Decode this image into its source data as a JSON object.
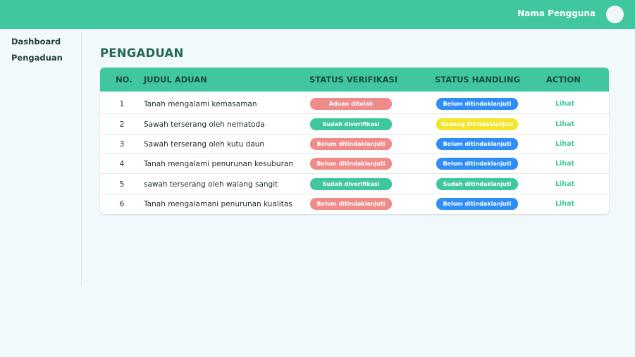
{
  "header": {
    "username": "Nama Pengguna"
  },
  "sidebar": {
    "items": [
      {
        "label": "Dashboard"
      },
      {
        "label": "Pengaduan"
      }
    ]
  },
  "page": {
    "title": "PENGADUAN"
  },
  "colors": {
    "accent": "#40c79f",
    "red": "#ef8b8b",
    "blue": "#2f8ef5",
    "yellow": "#f3e52b"
  },
  "table": {
    "columns": [
      "NO.",
      "JUDUL ADUAN",
      "STATUS VERIFIKASI",
      "STATUS HANDLING",
      "ACTION"
    ],
    "rows": [
      {
        "no": "1",
        "title": "Tanah mengalami kemasaman",
        "verif": "Aduan ditolak",
        "verif_color": "red",
        "handling": "Belum ditindaklanjuti",
        "handling_color": "blue",
        "action": "Lihat"
      },
      {
        "no": "2",
        "title": "Sawah terserang oleh nematoda",
        "verif": "Sudah diverifikasi",
        "verif_color": "green",
        "handling": "Sedang ditindaklanjuti",
        "handling_color": "yellow",
        "action": "Lihat"
      },
      {
        "no": "3",
        "title": "Sawah terserang oleh kutu daun",
        "verif": "Belum ditindaklanjuti",
        "verif_color": "red",
        "handling": "Belum ditindaklanjuti",
        "handling_color": "blue",
        "action": "Lihat"
      },
      {
        "no": "4",
        "title": "Tanah mengalami penurunan kesuburan",
        "verif": "Belum ditindaklanjuti",
        "verif_color": "red",
        "handling": "Belum ditindaklanjuti",
        "handling_color": "blue",
        "action": "Lihat"
      },
      {
        "no": "5",
        "title": "sawah terserang oleh walang sangit",
        "verif": "Sudah diverifikasi",
        "verif_color": "green",
        "handling": "Sudah ditindaklanjuti",
        "handling_color": "green",
        "action": "Lihat"
      },
      {
        "no": "6",
        "title": "Tanah mengalamani penurunan kualitas",
        "verif": "Belum ditindaklanjuti",
        "verif_color": "red",
        "handling": "Belum ditindaklanjuti",
        "handling_color": "blue",
        "action": "Lihat"
      }
    ]
  }
}
